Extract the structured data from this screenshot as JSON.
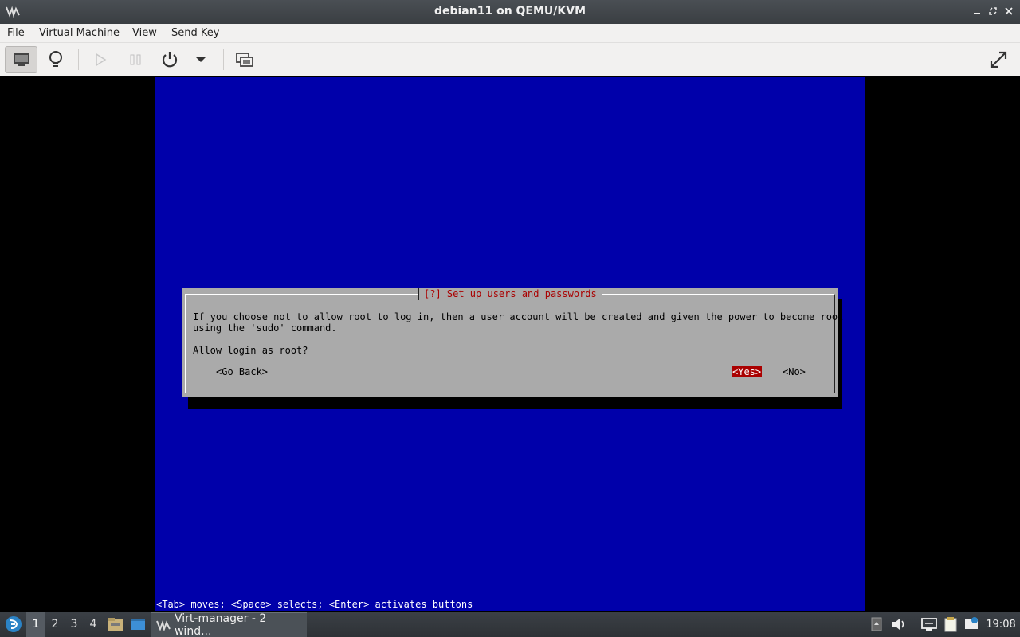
{
  "window": {
    "title": "debian11 on QEMU/KVM"
  },
  "menu": [
    "File",
    "Virtual Machine",
    "View",
    "Send Key"
  ],
  "colors": {
    "installer_bg": "#0000aa",
    "dialog_bg": "#aaaaaa",
    "accent_red": "#aa0000"
  },
  "installer": {
    "dialog_title": "[?] Set up users and passwords",
    "line1": "If you choose not to allow root to log in, then a user account will be created and given the power to become root",
    "line2": "using the 'sudo' command.",
    "question": "Allow login as root?",
    "go_back": "<Go Back>",
    "yes": "<Yes>",
    "no": "<No>",
    "help": "<Tab> moves; <Space> selects; <Enter> activates buttons"
  },
  "taskbar": {
    "desktops": [
      "1",
      "2",
      "3",
      "4"
    ],
    "task_label": "Virt-manager - 2 wind...",
    "clock": "19:08"
  }
}
